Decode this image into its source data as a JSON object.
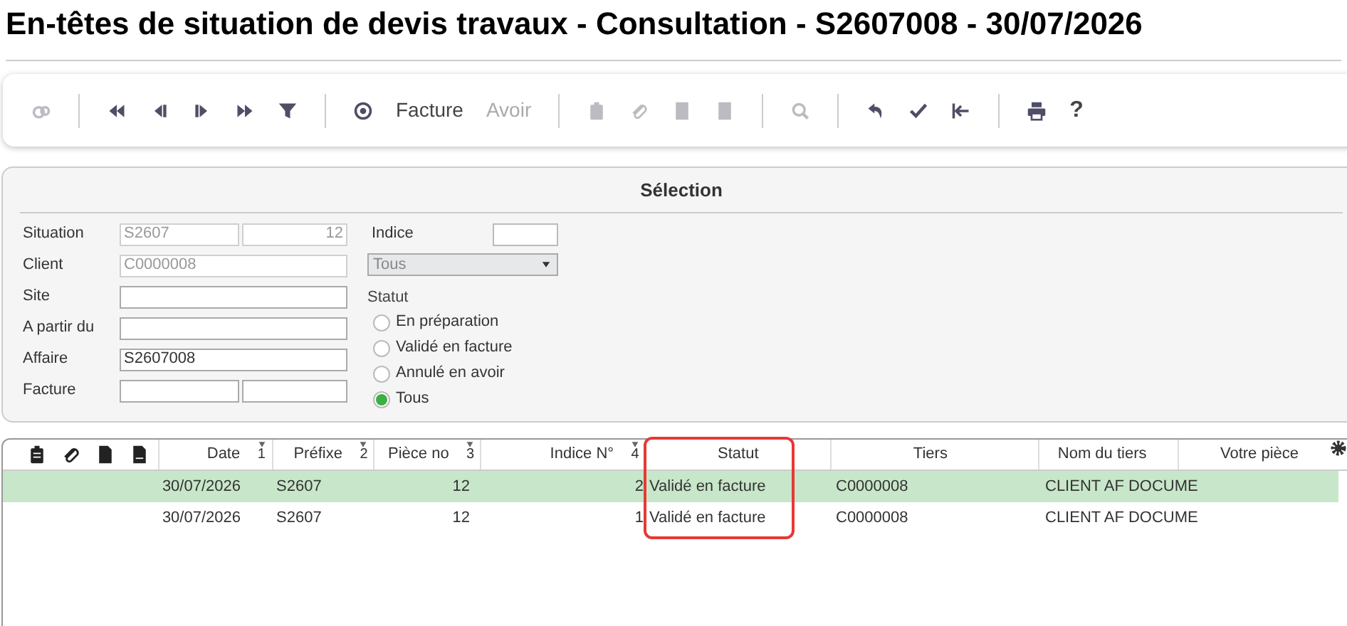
{
  "window": {
    "title": "En-têtes de situation de devis travaux - Consultation - S2607008 - 30/07/2026"
  },
  "toolbar": [
    {
      "kind": "link",
      "disabled": true
    },
    {
      "kind": "separator"
    },
    {
      "kind": "first",
      "disabled": false
    },
    {
      "kind": "previous",
      "disabled": false
    },
    {
      "kind": "next",
      "disabled": false
    },
    {
      "kind": "last",
      "disabled": false
    },
    {
      "kind": "filter",
      "disabled": false
    },
    {
      "kind": "separator"
    },
    {
      "kind": "target",
      "disabled": false
    },
    {
      "kind": "text",
      "label": "Facture",
      "disabled": false
    },
    {
      "kind": "text",
      "label": "Avoir",
      "disabled": true
    },
    {
      "kind": "separator"
    },
    {
      "kind": "clipboard",
      "disabled": true
    },
    {
      "kind": "paperclip",
      "disabled": true
    },
    {
      "kind": "save",
      "disabled": true
    },
    {
      "kind": "saveas",
      "disabled": true
    },
    {
      "kind": "separator"
    },
    {
      "kind": "search",
      "disabled": true
    },
    {
      "kind": "separator"
    },
    {
      "kind": "undo",
      "disabled": false
    },
    {
      "kind": "check",
      "disabled": false
    },
    {
      "kind": "tostart",
      "disabled": false
    },
    {
      "kind": "separator"
    },
    {
      "kind": "print",
      "disabled": false
    },
    {
      "kind": "text",
      "label": "?",
      "disabled": false
    }
  ],
  "selection": {
    "title": "Sélection",
    "fields": [
      {
        "label": "Situation",
        "kind": "pair",
        "values": [
          "S2607",
          "12"
        ],
        "disabled": true
      },
      {
        "label": "Client",
        "kind": "single",
        "values": [
          "C0000008"
        ],
        "disabled": true
      },
      {
        "label": "Site",
        "kind": "single",
        "disabled": false
      },
      {
        "label": "A partir du",
        "kind": "single",
        "disabled": false
      },
      {
        "label": "Affaire",
        "kind": "single",
        "values": [
          "S2607008"
        ],
        "disabled": false
      },
      {
        "label": "Facture",
        "kind": "pair",
        "disabled": false
      }
    ],
    "indice": {
      "label": "Indice"
    },
    "dropdown": {
      "value": "Tous",
      "disabled": true
    },
    "statut": {
      "label": "Statut",
      "options": [
        {
          "label": "En préparation",
          "selected": false
        },
        {
          "label": "Validé en facture",
          "selected": false
        },
        {
          "label": "Annulé en avoir",
          "selected": false
        },
        {
          "label": "Tous",
          "selected": true
        }
      ]
    }
  },
  "table": {
    "columns": [
      {
        "label": "Date",
        "sort": "1",
        "highlighted": false
      },
      {
        "label": "Préfixe",
        "sort": "2",
        "highlighted": false
      },
      {
        "label": "Pièce no",
        "sort": "3",
        "highlighted": false
      },
      {
        "label": "Indice N°",
        "sort": "4",
        "highlighted": false
      },
      {
        "label": "Statut",
        "highlighted": true
      },
      {
        "label": "Tiers",
        "highlighted": false
      },
      {
        "label": "Nom du tiers",
        "highlighted": false
      },
      {
        "label": "Votre pièce",
        "highlighted": false
      }
    ],
    "rows": [
      {
        "selected": true,
        "cells": [
          "30/07/2026",
          "S2607",
          "12",
          "2",
          "Validé en facture",
          "C0000008",
          "CLIENT AF  DOCUME"
        ]
      },
      {
        "selected": false,
        "cells": [
          "30/07/2026",
          "S2607",
          "12",
          "1",
          "Validé en facture",
          "C0000008",
          "CLIENT AF  DOCUME"
        ]
      }
    ]
  }
}
